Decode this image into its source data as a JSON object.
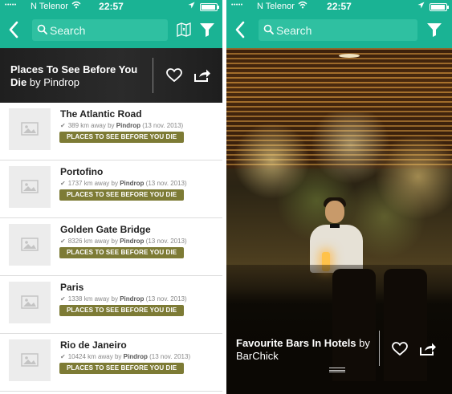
{
  "status_bar": {
    "signal": "•••••",
    "carrier": "N Telenor",
    "time": "22:57"
  },
  "search": {
    "placeholder": "Search"
  },
  "left_screen": {
    "header": {
      "title": "Places To See Before You Die",
      "by": "by",
      "author": "Pindrop"
    },
    "items": [
      {
        "name": "The Atlantic Road",
        "distance": "389 km away",
        "by": "by",
        "author": "Pindrop",
        "date": "(13 nov. 2013)",
        "tag": "PLACES TO SEE BEFORE YOU DIE"
      },
      {
        "name": "Portofino",
        "distance": "1737 km away",
        "by": "by",
        "author": "Pindrop",
        "date": "(13 nov. 2013)",
        "tag": "PLACES TO SEE BEFORE YOU DIE"
      },
      {
        "name": "Golden Gate Bridge",
        "distance": "8326 km away",
        "by": "by",
        "author": "Pindrop",
        "date": "(13 nov. 2013)",
        "tag": "PLACES TO SEE BEFORE YOU DIE"
      },
      {
        "name": "Paris",
        "distance": "1338 km away",
        "by": "by",
        "author": "Pindrop",
        "date": "(13 nov. 2013)",
        "tag": "PLACES TO SEE BEFORE YOU DIE"
      },
      {
        "name": "Rio de Janeiro",
        "distance": "10424 km away",
        "by": "by",
        "author": "Pindrop",
        "date": "(13 nov. 2013)",
        "tag": "PLACES TO SEE BEFORE YOU DIE"
      }
    ]
  },
  "right_screen": {
    "title": "Favourite Bars In Hotels",
    "by": "by",
    "author": "BarChick"
  },
  "icons": {
    "back": "chevron-left-icon",
    "search": "magnifier-icon",
    "map": "map-icon",
    "filter": "funnel-icon",
    "favorite": "heart-outline-icon",
    "share": "share-icon",
    "placeholder": "image-placeholder-icon",
    "check": "check-icon",
    "wifi": "wifi-icon",
    "location": "location-arrow-icon",
    "battery": "battery-icon"
  },
  "colors": {
    "brand_green": "#1ab394",
    "search_bg": "#2fc0a1",
    "tag_olive": "#7d7b35"
  }
}
